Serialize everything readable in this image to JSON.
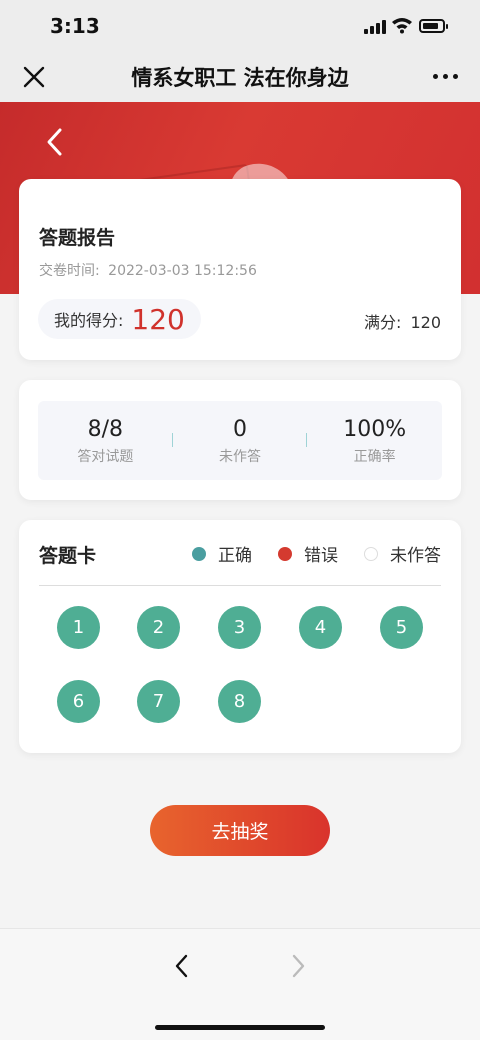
{
  "status": {
    "time": "3:13"
  },
  "nav": {
    "title": "情系女职工 法在你身边"
  },
  "report": {
    "title": "答题报告",
    "submit_label": "交卷时间:",
    "submit_time": "2022-03-03 15:12:56",
    "score_label": "我的得分:",
    "score_value": "120",
    "full_label": "满分:",
    "full_value": "120"
  },
  "stats": [
    {
      "value": "8/8",
      "label": "答对试题"
    },
    {
      "value": "0",
      "label": "未作答"
    },
    {
      "value": "100%",
      "label": "正确率"
    }
  ],
  "answer_sheet": {
    "title": "答题卡",
    "legend": [
      {
        "label": "正确",
        "color": "#4a9ea0"
      },
      {
        "label": "错误",
        "color": "#d43a2f"
      },
      {
        "label": "未作答",
        "color": "#ffffff"
      }
    ],
    "questions": [
      "1",
      "2",
      "3",
      "4",
      "5",
      "6",
      "7",
      "8"
    ]
  },
  "draw_button": "去抽奖",
  "colors": {
    "accent": "#d0322c",
    "correct": "#4fae94"
  }
}
